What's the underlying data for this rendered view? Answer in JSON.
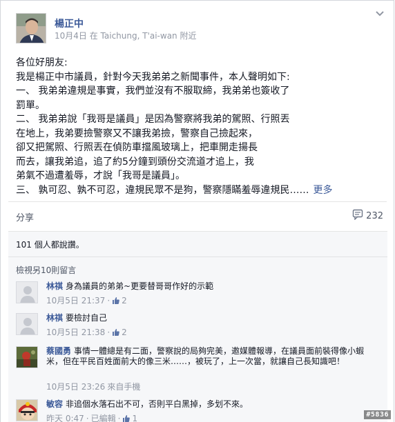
{
  "post": {
    "author": "楊正中",
    "date": "10月4日",
    "location_text": "在 Taichung, T'ai-wan 附近",
    "body_lines": [
      "各位好朋友:",
      "我是楊正中市議員，針對今天我弟弟之新聞事件，本人聲明如下:",
      "一、 我弟弟違規是事實，我們並沒有不服取締，我弟弟也簽收了",
      "罰單。",
      "二、 我弟弟說「我哥是議員」是因為警察將我弟的駕照、行照丟",
      "在地上，我弟要撿警察又不讓我弟撿，警察自己撿起來，",
      "卻又把駕照、行照丟在偵防車擋風玻璃上，把車開走揚長",
      "而去，讓我弟追，追了約5分鐘到頭份交流道才追上，我",
      "弟氣不過遭羞辱，才說「我哥是議員」。",
      "三、 孰可忍、孰不可忍，違規民眾不是狗，警察隱瞞羞辱違規民……"
    ],
    "more_label": "更多"
  },
  "actions": {
    "share_label": "分享",
    "comment_count": "232"
  },
  "likes_text": "101 個人都說讚。",
  "view_more_comments": "檢視另10則留言",
  "comments": [
    {
      "name": "林祺",
      "text": "身為議員的弟弟~更要替哥哥作好的示範",
      "time": "10月5日 21:37",
      "likes": "2",
      "avatar": "default-avatar"
    },
    {
      "name": "林祺",
      "text": "要檢討自己",
      "time": "10月5日 21:38",
      "likes": "2",
      "avatar": "default-avatar"
    },
    {
      "name": "蔡國勇",
      "text": "事情一體總是有二面，警察說的局夠完美，邀媒體報導，在議員面前裝得像小蝦米，但在平民百姓面前大的像三米……，被玩了，上一次當，就讓自己長知識吧！",
      "time": "10月5日 23:26",
      "via": "來自手機",
      "likes": "",
      "avatar": "photo-avatar-red"
    },
    {
      "name": "敏容",
      "text": "非追個水落石出不可，否則平白黑掉，多划不來。",
      "time": "昨天 0:47",
      "via": "已編輯",
      "likes": "1",
      "avatar": "photo-avatar-mask"
    }
  ],
  "watermark": "#5836",
  "colors": {
    "link_blue": "#3b5998",
    "meta_gray": "#9197a3",
    "panel_bg": "#f6f7f9"
  }
}
